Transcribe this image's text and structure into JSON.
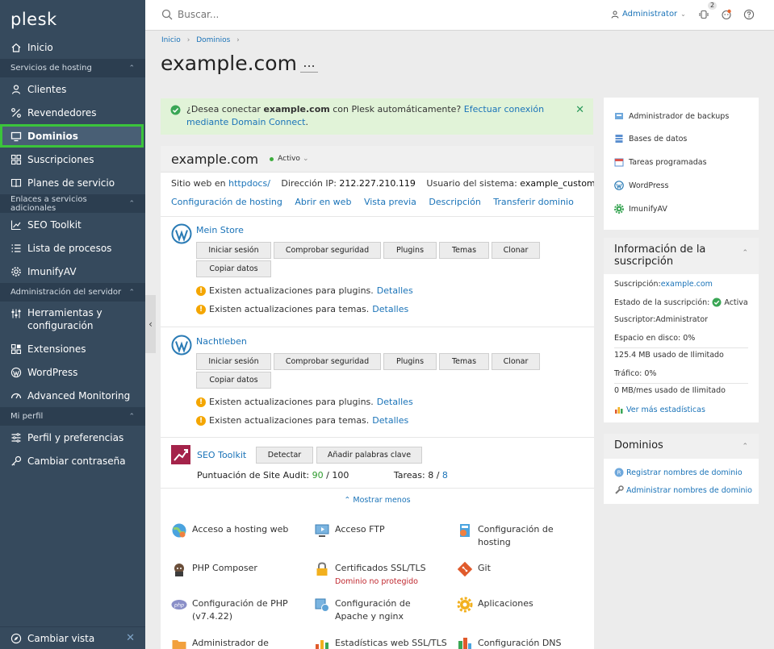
{
  "sidebar": {
    "logo_main": "plesk",
    "items": [
      {
        "label": "Inicio"
      },
      {
        "section": "Servicios de hosting"
      },
      {
        "label": "Clientes"
      },
      {
        "label": "Revendedores"
      },
      {
        "label": "Dominios"
      },
      {
        "label": "Suscripciones"
      },
      {
        "label": "Planes de servicio"
      },
      {
        "section": "Enlaces a servicios adicionales"
      },
      {
        "label": "SEO Toolkit"
      },
      {
        "label": "Lista de procesos"
      },
      {
        "label": "ImunifyAV"
      },
      {
        "section": "Administración del servidor"
      },
      {
        "label": "Herramientas y configuración"
      },
      {
        "label": "Extensiones"
      },
      {
        "label": "WordPress"
      },
      {
        "label": "Advanced Monitoring"
      },
      {
        "section": "Mi perfil"
      },
      {
        "label": "Perfil y preferencias"
      },
      {
        "label": "Cambiar contraseña"
      }
    ],
    "footer_label": "Cambiar vista"
  },
  "topbar": {
    "search_placeholder": "Buscar...",
    "user_label": "Administrator",
    "notifications_count": "2"
  },
  "header": {
    "breadcrumb_home": "Inicio",
    "breadcrumb_domains": "Dominios",
    "title": "example.com",
    "more": "..."
  },
  "notice": {
    "text_before": "¿Desea conectar ",
    "domain": "example.com",
    "text_after": " con Plesk automáticamente? ",
    "link": "Efectuar conexión mediante Domain Connect",
    "end": "."
  },
  "domain_panel": {
    "name": "example.com",
    "status": "Activo",
    "website_label": "Sitio web en ",
    "website_value": "httpdocs/",
    "ip_label": "Dirección IP: ",
    "ip_value": "212.227.210.119",
    "sysuser_label": "Usuario del sistema: ",
    "sysuser_value": "example_customer",
    "links": [
      "Configuración de hosting",
      "Abrir en web",
      "Vista previa",
      "Descripción",
      "Transferir dominio"
    ],
    "wordpress_sites": [
      {
        "name": "Mein Store",
        "buttons": [
          "Iniciar sesión",
          "Comprobar seguridad",
          "Plugins",
          "Temas",
          "Clonar",
          "Copiar datos"
        ],
        "warnings": [
          {
            "text": "Existen actualizaciones para plugins.",
            "link": "Detalles"
          },
          {
            "text": "Existen actualizaciones para temas.",
            "link": "Detalles"
          }
        ]
      },
      {
        "name": "Nachtleben",
        "buttons": [
          "Iniciar sesión",
          "Comprobar seguridad",
          "Plugins",
          "Temas",
          "Clonar",
          "Copiar datos"
        ],
        "warnings": [
          {
            "text": "Existen actualizaciones para plugins.",
            "link": "Detalles"
          },
          {
            "text": "Existen actualizaciones para temas.",
            "link": "Detalles"
          }
        ]
      }
    ],
    "seo": {
      "name": "SEO Toolkit",
      "buttons": [
        "Detectar",
        "Añadir palabras clave"
      ],
      "audit_label": "Puntuación de Site Audit: ",
      "audit_score": "90",
      "audit_total": " / 100",
      "tasks_label": "Tareas: ",
      "tasks_done": "8",
      "tasks_sep": " / ",
      "tasks_total": "8"
    },
    "show_less": "Mostrar menos",
    "tools": [
      {
        "label": "Acceso a hosting web"
      },
      {
        "label": "Acceso FTP"
      },
      {
        "label": "Configuración de hosting"
      },
      {
        "label": "PHP Composer"
      },
      {
        "label": "Certificados SSL/TLS",
        "sub": "Dominio no protegido"
      },
      {
        "label": "Git"
      },
      {
        "label": "Configuración de PHP (v7.4.22)"
      },
      {
        "label": "Configuración de Apache y nginx"
      },
      {
        "label": "Aplicaciones"
      },
      {
        "label": "Administrador de"
      },
      {
        "label": "Estadísticas web SSL/TLS"
      },
      {
        "label": "Configuración DNS"
      }
    ]
  },
  "right": {
    "quick_links": [
      "Administrador de backups",
      "Bases de datos",
      "Tareas programadas",
      "WordPress",
      "ImunifyAV"
    ],
    "subscription": {
      "title": "Información de la suscripción",
      "subscription_label": "Suscripción: ",
      "subscription_value": "example.com",
      "state_label": "Estado de la suscripción: ",
      "state_value": "Activa",
      "subscriber_label": "Suscriptor: ",
      "subscriber_value": "Administrator",
      "disk_label": "Espacio en disco: 0%",
      "disk_usage": "125.4 MB usado de Ilimitado",
      "traffic_label": "Tráfico: 0%",
      "traffic_usage": "0 MB/mes usado de Ilimitado",
      "more_stats": "Ver más estadísticas"
    },
    "domains": {
      "title": "Dominios",
      "register": "Registrar nombres de dominio",
      "manage": "Administrar nombres de dominio"
    }
  },
  "colors": {
    "sidebar_bg": "#364a5d",
    "section_bg": "#2c3e50",
    "active_outline": "#3bc43b",
    "link": "#1a73b8",
    "notice_bg": "#e1f3d8",
    "warning": "#f4a600"
  }
}
